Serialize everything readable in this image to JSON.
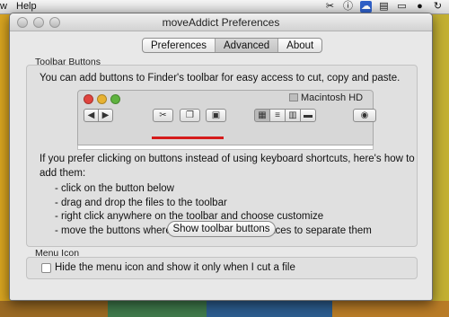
{
  "menubar": {
    "items": [
      "w",
      "Help"
    ],
    "tray_icons": [
      "scissors-icon",
      "info-icon",
      "cloud-icon",
      "document-icon",
      "screen-icon",
      "hat-icon",
      "refresh-icon"
    ]
  },
  "window": {
    "title": "moveAddict Preferences",
    "tabs": [
      {
        "label": "Preferences",
        "active": false
      },
      {
        "label": "Advanced",
        "active": true
      },
      {
        "label": "About",
        "active": false
      }
    ]
  },
  "toolbar_section": {
    "label": "Toolbar Buttons",
    "intro": "You can add buttons to Finder's toolbar for easy access to cut, copy and paste.",
    "finder_preview": {
      "volume_name": "Macintosh HD"
    },
    "instructions_line1": "If you prefer clicking on buttons instead of using keyboard shortcuts, here's how to",
    "instructions_line2": "add them:",
    "steps": [
      "- click on the button below",
      "- drag and drop the files to the toolbar",
      "- right click anywhere on the toolbar and choose customize",
      "- move the buttons where you want and add spaces to separate them"
    ],
    "button_label": "Show toolbar buttons"
  },
  "menu_icon_section": {
    "label": "Menu Icon",
    "checkbox_label": "Hide the menu icon and show it only when I cut a file",
    "checked": false
  },
  "colors": {
    "accent_underline": "#d51b1b",
    "close": "#e0443e",
    "minimize": "#e7b232",
    "zoom": "#5fb33f"
  }
}
